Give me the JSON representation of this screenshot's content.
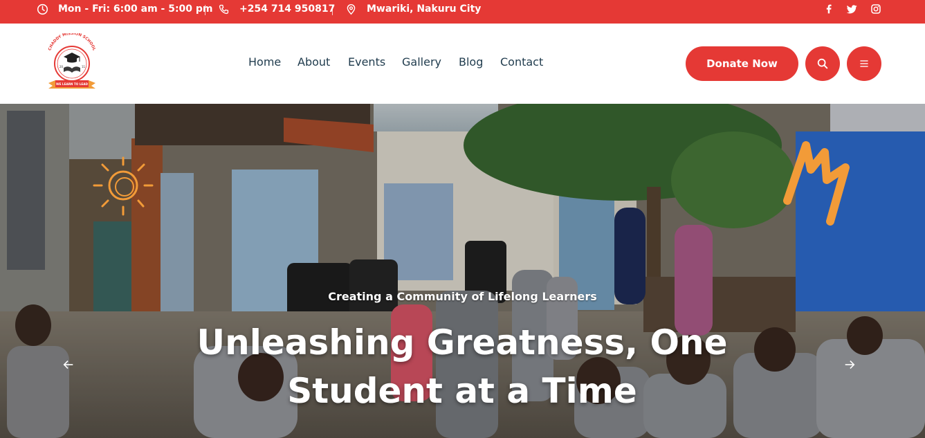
{
  "topbar": {
    "hours": "Mon - Fri: 6:00 am - 5:00 pm",
    "phone": "+254 714 950817",
    "location": "Mwariki, Nakuru City",
    "social": [
      "facebook-icon",
      "twitter-icon",
      "instagram-icon"
    ]
  },
  "logo": {
    "name": "CHADDY MISSION SCHOOL",
    "motto": "WE LEARN TO LEAD",
    "year_left": "20",
    "year_right": "11"
  },
  "nav": {
    "items": [
      {
        "label": "Home"
      },
      {
        "label": "About"
      },
      {
        "label": "Events"
      },
      {
        "label": "Gallery"
      },
      {
        "label": "Blog"
      },
      {
        "label": "Contact"
      }
    ]
  },
  "header_actions": {
    "donate_label": "Donate Now",
    "search_icon": "search-icon",
    "menu_icon": "hamburger-menu-icon"
  },
  "hero": {
    "tagline": "Creating a Community of Lifelong Learners",
    "title": "Unleashing Greatness, One Student at a Time",
    "prev_icon": "arrow-left-icon",
    "next_icon": "arrow-right-icon"
  },
  "colors": {
    "brand_red": "#e53935",
    "nav_text": "#1f3b4d",
    "accent_orange": "#f29b38"
  }
}
